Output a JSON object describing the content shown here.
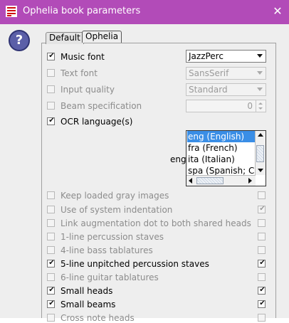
{
  "window": {
    "title": "Ophelia book parameters",
    "title_bar_color": "#b24bb8",
    "app_icon": "audiveris-icon",
    "close_symbol": "✕"
  },
  "help": {
    "symbol": "?"
  },
  "tabs": [
    {
      "label": "Default",
      "selected": false
    },
    {
      "label": "Ophelia",
      "selected": true
    }
  ],
  "params": {
    "music_font": {
      "label": "Music font",
      "checked": true,
      "enabled": true,
      "value": "JazzPerc"
    },
    "text_font": {
      "label": "Text font",
      "checked": false,
      "enabled": false,
      "value": "SansSerif"
    },
    "input_quality": {
      "label": "Input quality",
      "checked": false,
      "enabled": false,
      "value": "Standard"
    },
    "beam_spec": {
      "label": "Beam specification",
      "checked": false,
      "enabled": false,
      "value": "0"
    },
    "ocr_languages": {
      "label": "OCR language(s)",
      "checked": true,
      "enabled": true,
      "selection_text": "eng",
      "options": [
        "eng (English)",
        "fra (French)",
        "ita (Italian)",
        "spa (Spanish; Ca"
      ],
      "selected_index": 0
    }
  },
  "switches": [
    {
      "label": "Keep loaded gray images",
      "override": false,
      "enabled": false,
      "value": false
    },
    {
      "label": "Use of system indentation",
      "override": false,
      "enabled": false,
      "value": true
    },
    {
      "label": "Link augmentation dot to both shared heads",
      "override": false,
      "enabled": false,
      "value": false
    },
    {
      "label": "1-line percussion staves",
      "override": false,
      "enabled": false,
      "value": false
    },
    {
      "label": "4-line bass tablatures",
      "override": false,
      "enabled": false,
      "value": false
    },
    {
      "label": "5-line unpitched percussion staves",
      "override": true,
      "enabled": true,
      "value": true
    },
    {
      "label": "6-line guitar tablatures",
      "override": false,
      "enabled": false,
      "value": false
    },
    {
      "label": "Small heads",
      "override": true,
      "enabled": true,
      "value": true
    },
    {
      "label": "Small beams",
      "override": true,
      "enabled": true,
      "value": true
    },
    {
      "label": "Cross note heads",
      "override": false,
      "enabled": false,
      "value": false
    }
  ],
  "check_mark": "✔"
}
